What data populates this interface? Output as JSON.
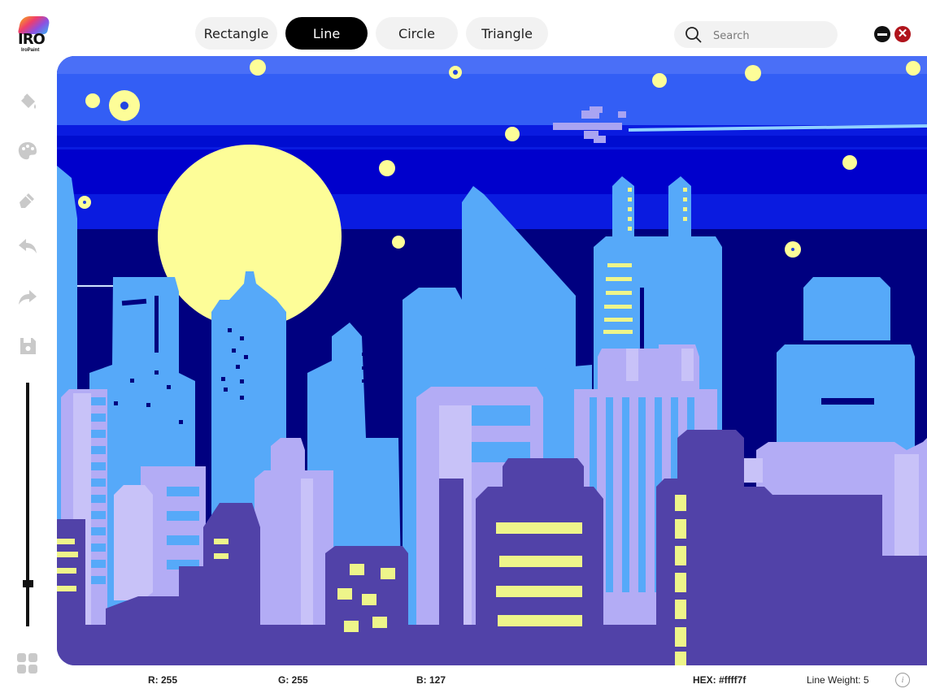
{
  "app": {
    "logo_text": "IRO",
    "logo_sub": "IroPaint"
  },
  "toolbar": {
    "shapes": [
      {
        "label": "Rectangle",
        "active": false
      },
      {
        "label": "Line",
        "active": true
      },
      {
        "label": "Circle",
        "active": false
      },
      {
        "label": "Triangle",
        "active": false
      }
    ]
  },
  "search": {
    "placeholder": "Search"
  },
  "sidebar": {
    "icons": [
      "fill-bucket-icon",
      "palette-icon",
      "eraser-icon",
      "undo-icon",
      "redo-icon",
      "save-icon"
    ],
    "bottom_icon": "grid-menu-icon",
    "brush_size_slider": 0.18
  },
  "statusbar": {
    "r": "R: 255",
    "g": "G: 255",
    "b": "B: 127",
    "hex": "HEX: #ffff7f",
    "line_weight": "Line Weight: 5"
  },
  "colors": {
    "sky_top": "#335ef5",
    "sky_mid": "#0a1be0",
    "sky_deep": "#000080",
    "moon": "#fdfd98",
    "building_light": "#56a9f9",
    "building_lavender": "#b3acf5",
    "building_purple": "#5142a8",
    "window_yellow": "#eef58a",
    "close_red": "#b0141c"
  }
}
